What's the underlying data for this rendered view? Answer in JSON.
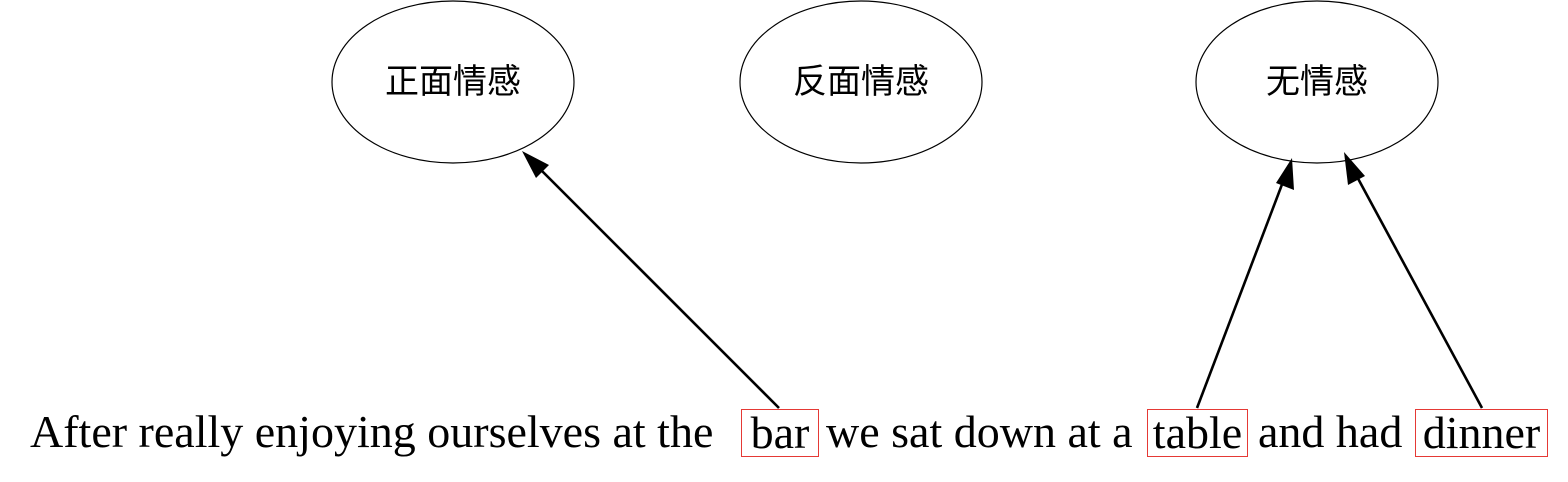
{
  "nodes": [
    {
      "id": "pos",
      "label": "正面情感"
    },
    {
      "id": "neg",
      "label": "反面情感"
    },
    {
      "id": "none",
      "label": "无情感"
    }
  ],
  "sentence": {
    "segment_1": "After really enjoying ourselves at the",
    "aspect_bar": "bar",
    "segment_2": "we sat down at a",
    "aspect_table": "table",
    "segment_3": "and had",
    "aspect_dinner": "dinner"
  },
  "edges": [
    {
      "from": "bar",
      "to": "正面情感"
    },
    {
      "from": "table",
      "to": "无情感"
    },
    {
      "from": "dinner",
      "to": "无情感"
    }
  ],
  "colors": {
    "box_border": "#e53935",
    "stroke": "#000000"
  }
}
